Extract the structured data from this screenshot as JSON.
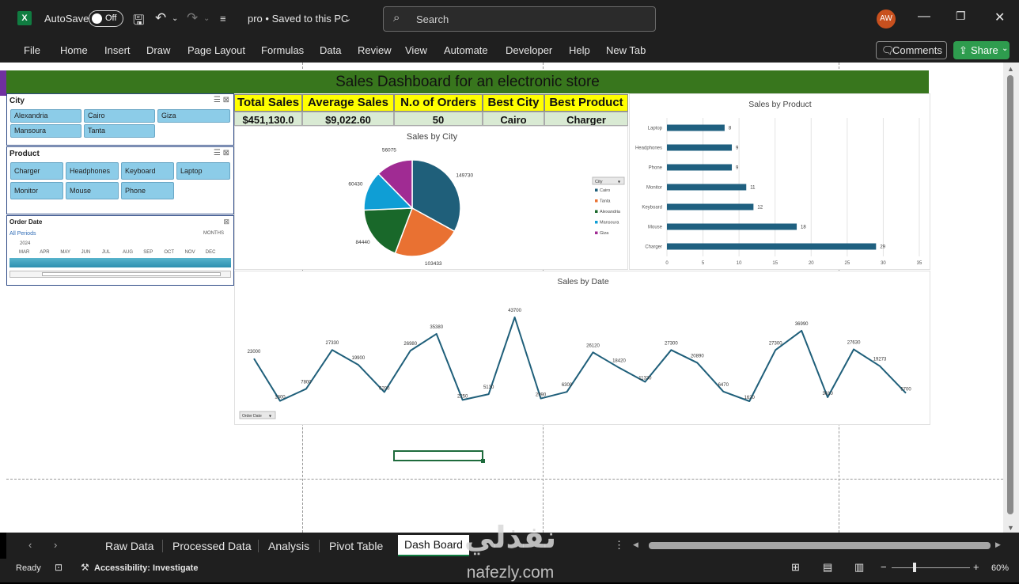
{
  "titlebar": {
    "autosave_label": "AutoSave",
    "autosave_state": "Off",
    "doc_title": "pro • Saved to this PC",
    "search_placeholder": "Search",
    "avatar_initials": "AW"
  },
  "menu": {
    "tabs": [
      "File",
      "Home",
      "Insert",
      "Draw",
      "Page Layout",
      "Formulas",
      "Data",
      "Review",
      "View",
      "Automate",
      "Developer",
      "Help",
      "New Tab"
    ],
    "comments_label": "Comments",
    "share_label": "Share"
  },
  "dashboard": {
    "banner_title": "Sales Dashboard for an electronic store",
    "kpi_headers": [
      "Total Sales",
      "Average Sales",
      "N.o of Orders",
      "Best City",
      "Best Product"
    ],
    "kpi_values": [
      "$451,130.0",
      "$9,022.60",
      "50",
      "Cairo",
      "Charger"
    ],
    "city_slicer": {
      "title": "City",
      "items": [
        "Alexandria",
        "Cairo",
        "Giza",
        "Mansoura",
        "Tanta"
      ]
    },
    "product_slicer": {
      "title": "Product",
      "items": [
        "Charger",
        "Headphones",
        "Keyboard",
        "Laptop",
        "Monitor",
        "Mouse",
        "Phone"
      ]
    },
    "timeline": {
      "title": "Order Date",
      "period": "All Periods",
      "unit": "MONTHS",
      "year": "2024",
      "months": [
        "MAR",
        "APR",
        "MAY",
        "JUN",
        "JUL",
        "AUG",
        "SEP",
        "OCT",
        "NOV",
        "DEC"
      ]
    }
  },
  "sheet_tabs": {
    "tabs": [
      "Raw Data",
      "Processed Data",
      "Analysis",
      "Pivot Table",
      "Dash Board"
    ],
    "active": "Dash Board"
  },
  "status": {
    "ready": "Ready",
    "accessibility": "Accessibility: Investigate",
    "zoom": "60%"
  },
  "watermark": {
    "arabic": "نفذلي",
    "latin": "nafezly.com"
  },
  "colors": {
    "excel_green": "#107c41",
    "banner_green": "#38761d",
    "kpi_yellow": "#ffff00",
    "bar_teal": "#1f6080",
    "line_teal": "#1f5f7a"
  },
  "chart_data": [
    {
      "type": "pie",
      "title": "Sales by City",
      "legend_header": "City",
      "categories": [
        "Cairo",
        "Tanta",
        "Alexandria",
        "Mansoura",
        "Giza"
      ],
      "values": [
        149730,
        103433,
        84440,
        60430,
        56075
      ],
      "colors": [
        "#1f5f7a",
        "#e97132",
        "#19682a",
        "#0f9ed5",
        "#a02b93"
      ]
    },
    {
      "type": "bar",
      "title": "Sales by Product",
      "orientation": "horizontal",
      "categories": [
        "Laptop",
        "Headphones",
        "Phone",
        "Monitor",
        "Keyboard",
        "Mouse",
        "Charger"
      ],
      "values": [
        8,
        9,
        9,
        11,
        12,
        18,
        29
      ],
      "xlim": [
        0,
        35
      ],
      "xticks": [
        0,
        5,
        10,
        15,
        20,
        25,
        30,
        35
      ]
    },
    {
      "type": "line",
      "title": "Sales by Date",
      "filter_label": "Order Date",
      "values": [
        23000,
        1800,
        7800,
        27330,
        19900,
        6200,
        26980,
        35380,
        2250,
        5130,
        43700,
        2990,
        6300,
        26120,
        18420,
        11330,
        27300,
        20890,
        6470,
        1620,
        27300,
        36990,
        3610,
        27630,
        19273,
        5700
      ]
    }
  ]
}
